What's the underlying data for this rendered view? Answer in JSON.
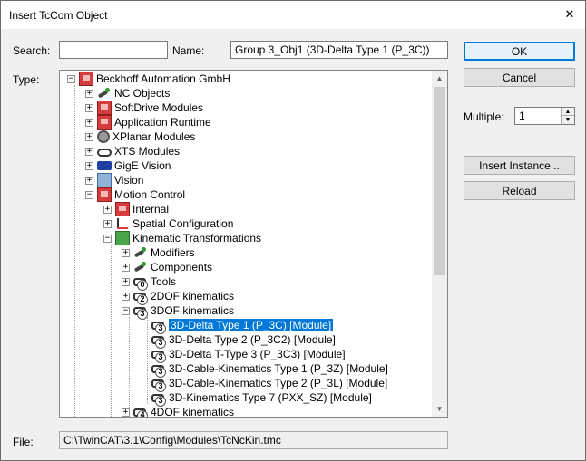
{
  "window": {
    "title": "Insert TcCom Object",
    "close_glyph": "✕"
  },
  "search": {
    "label": "Search:",
    "value": ""
  },
  "name": {
    "label": "Name:",
    "value": "Group 3_Obj1 (3D-Delta Type 1 (P_3C))"
  },
  "type_label": "Type:",
  "buttons": {
    "ok": "OK",
    "cancel": "Cancel",
    "insert_instance": "Insert Instance...",
    "reload": "Reload"
  },
  "multiple": {
    "label": "Multiple:",
    "value": "1"
  },
  "file": {
    "label": "File:",
    "value": "C:\\TwinCAT\\3.1\\Config\\Modules\\TcNcKin.tmc"
  },
  "tree": {
    "items": [
      {
        "label": "Beckhoff Automation GmbH",
        "icon": "beckhoff-icon",
        "expander": "−"
      },
      {
        "label": "NC Objects",
        "icon": "nc-objects-icon",
        "expander": "+"
      },
      {
        "label": "SoftDrive Modules",
        "icon": "module-icon",
        "expander": "+"
      },
      {
        "label": "Application Runtime",
        "icon": "module-icon",
        "expander": "+"
      },
      {
        "label": "XPlanar Modules",
        "icon": "xplanar-icon",
        "expander": "+"
      },
      {
        "label": "XTS Modules",
        "icon": "xts-icon",
        "expander": "+"
      },
      {
        "label": "GigE Vision",
        "icon": "camera-icon",
        "expander": "+"
      },
      {
        "label": "Vision",
        "icon": "vision-icon",
        "expander": "+"
      },
      {
        "label": "Motion Control",
        "icon": "module-icon",
        "expander": "−"
      },
      {
        "label": "Internal",
        "icon": "module-icon",
        "expander": "+"
      },
      {
        "label": "Spatial Configuration",
        "icon": "axes-icon",
        "expander": "+"
      },
      {
        "label": "Kinematic Transformations",
        "icon": "kinematics-icon",
        "expander": "−"
      },
      {
        "label": "Modifiers",
        "icon": "link-icon",
        "expander": "+"
      },
      {
        "label": "Components",
        "icon": "link-icon",
        "expander": "+"
      },
      {
        "label": "Tools",
        "icon": "tool-icon",
        "expander": "+"
      },
      {
        "label": "2DOF kinematics",
        "icon": "kin2-icon",
        "expander": "+"
      },
      {
        "label": "3DOF kinematics",
        "icon": "kin3-icon",
        "expander": "−"
      },
      {
        "label": "3D-Delta Type 1 (P_3C) [Module]",
        "icon": "kin3-icon",
        "expander": ""
      },
      {
        "label": "3D-Delta Type 2 (P_3C2) [Module]",
        "icon": "kin3-icon",
        "expander": ""
      },
      {
        "label": "3D-Delta T-Type 3 (P_3C3)  [Module]",
        "icon": "kin3-icon",
        "expander": ""
      },
      {
        "label": "3D-Cable-Kinematics Type 1 (P_3Z) [Module]",
        "icon": "kin3-icon",
        "expander": ""
      },
      {
        "label": "3D-Cable-Kinematics Type 2 (P_3L) [Module]",
        "icon": "kin3-icon",
        "expander": ""
      },
      {
        "label": "3D-Kinematics Type 7 (PXX_SZ) [Module]",
        "icon": "kin3-icon",
        "expander": ""
      },
      {
        "label": "4DOF kinematics",
        "icon": "kin4-icon",
        "expander": "+"
      }
    ]
  },
  "scroll": {
    "up_glyph": "▲",
    "down_glyph": "▼"
  }
}
